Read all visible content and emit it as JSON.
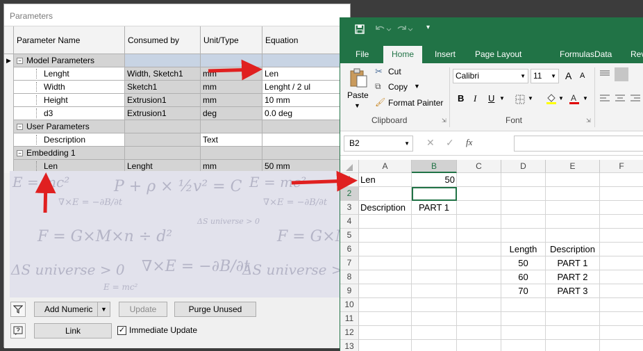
{
  "params_window": {
    "title": "Parameters",
    "columns": [
      "Parameter Name",
      "Consumed by",
      "Unit/Type",
      "Equation"
    ],
    "rows": [
      {
        "kind": "group",
        "expander": "−",
        "name": "Model Parameters",
        "consumed": "",
        "unit": "",
        "equation": ""
      },
      {
        "kind": "leaf",
        "name": "Lenght",
        "consumed": "Width, Sketch1",
        "unit": "mm",
        "equation": "Len"
      },
      {
        "kind": "leaf",
        "name": "Width",
        "consumed": "Sketch1",
        "unit": "mm",
        "equation": "Lenght / 2 ul"
      },
      {
        "kind": "leaf",
        "name": "Height",
        "consumed": "Extrusion1",
        "unit": "mm",
        "equation": "10 mm"
      },
      {
        "kind": "leaf",
        "name": "d3",
        "consumed": "Extrusion1",
        "unit": "deg",
        "equation": "0.0 deg"
      },
      {
        "kind": "group",
        "expander": "−",
        "name": "User Parameters",
        "consumed": "",
        "unit": "",
        "equation": ""
      },
      {
        "kind": "leaf",
        "name": "Description",
        "consumed": "",
        "unit": "Text",
        "equation": ""
      },
      {
        "kind": "group",
        "expander": "−",
        "name": "Embedding 1",
        "consumed": "",
        "unit": "",
        "equation": ""
      },
      {
        "kind": "leaf",
        "name": "Len",
        "consumed": "Lenght",
        "unit": "mm",
        "equation": "50 mm"
      }
    ],
    "row_pointer": "▶",
    "buttons": {
      "add_numeric": "Add Numeric",
      "update": "Update",
      "purge_unused": "Purge Unused",
      "link": "Link",
      "immediate_update": "Immediate Update",
      "immediate_update_checked": true
    },
    "icons": {
      "filter": "filter-icon",
      "help": "help-icon",
      "dropdown": "chevron-down-icon"
    }
  },
  "excel": {
    "tabs": [
      "File",
      "Home",
      "Insert",
      "Page Layout",
      "Formulas",
      "Data",
      "Rev"
    ],
    "active_tab": "Home",
    "clipboard": {
      "paste": "Paste",
      "cut": "Cut",
      "copy": "Copy",
      "format_painter": "Format Painter",
      "group_label": "Clipboard"
    },
    "font": {
      "name": "Calibri",
      "size": "11",
      "group_label": "Font",
      "bold": "B",
      "italic": "I",
      "underline": "U",
      "grow": "A",
      "shrink": "A"
    },
    "name_box": "B2",
    "fx_label": "fx",
    "columns": [
      "A",
      "B",
      "C",
      "D",
      "E",
      "F"
    ],
    "selected_column": "B",
    "selected_row": "2",
    "rows": [
      {
        "n": "1",
        "cells": [
          "Len",
          "50",
          "",
          "",
          "",
          ""
        ]
      },
      {
        "n": "2",
        "cells": [
          "",
          "",
          "",
          "",
          "",
          ""
        ]
      },
      {
        "n": "3",
        "cells": [
          "Description",
          "PART 1",
          "",
          "",
          "",
          ""
        ]
      },
      {
        "n": "4",
        "cells": [
          "",
          "",
          "",
          "",
          "",
          ""
        ]
      },
      {
        "n": "5",
        "cells": [
          "",
          "",
          "",
          "",
          "",
          ""
        ]
      },
      {
        "n": "6",
        "cells": [
          "",
          "",
          "",
          "Length",
          "Description",
          ""
        ]
      },
      {
        "n": "7",
        "cells": [
          "",
          "",
          "",
          "50",
          "PART 1",
          ""
        ]
      },
      {
        "n": "8",
        "cells": [
          "",
          "",
          "",
          "60",
          "PART 2",
          ""
        ]
      },
      {
        "n": "9",
        "cells": [
          "",
          "",
          "",
          "70",
          "PART 3",
          ""
        ]
      },
      {
        "n": "10",
        "cells": [
          "",
          "",
          "",
          "",
          "",
          ""
        ]
      },
      {
        "n": "11",
        "cells": [
          "",
          "",
          "",
          "",
          "",
          ""
        ]
      },
      {
        "n": "12",
        "cells": [
          "",
          "",
          "",
          "",
          "",
          ""
        ]
      },
      {
        "n": "13",
        "cells": [
          "",
          "",
          "",
          "",
          "",
          ""
        ]
      }
    ],
    "colors": {
      "brand": "#217346",
      "ribbon": "#f3f3f3"
    }
  },
  "annotation_color": "#e02020"
}
